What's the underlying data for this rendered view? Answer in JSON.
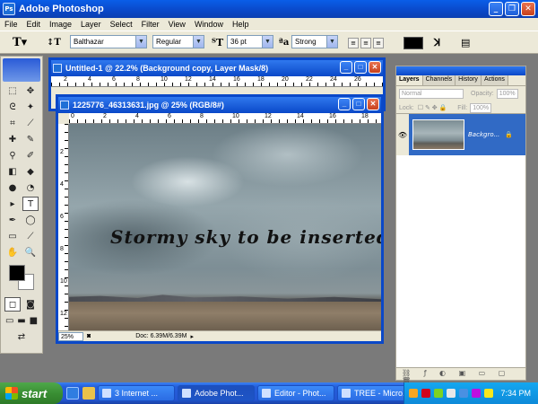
{
  "app": {
    "title": "Adobe Photoshop",
    "logo_text": "Ps"
  },
  "menu": [
    "File",
    "Edit",
    "Image",
    "Layer",
    "Select",
    "Filter",
    "View",
    "Window",
    "Help"
  ],
  "options": {
    "font_family": "Balthazar",
    "font_style": "Regular",
    "font_size": "36 pt",
    "aa_label": "a",
    "antialias": "Strong"
  },
  "doc_back": {
    "title": "Untitled-1 @ 22.2% (Background copy, Layer Mask/8)"
  },
  "doc_front": {
    "title": "1225776_46313631.jpg @ 25% (RGB/8#)",
    "caption": "Stormy sky to be inserted",
    "zoom": "25%",
    "doc_info": "Doc: 6.39M/6.39M",
    "ruler_h": [
      "0",
      "2",
      "4",
      "6",
      "8",
      "10",
      "12",
      "14",
      "16",
      "18"
    ],
    "ruler_v": [
      "2",
      "4",
      "6",
      "8",
      "10",
      "12"
    ]
  },
  "doc_back_ruler": [
    "2",
    "4",
    "6",
    "8",
    "10",
    "12",
    "14",
    "16",
    "18",
    "20",
    "22",
    "24",
    "26"
  ],
  "layers_panel": {
    "tabs": [
      "Layers",
      "Channels",
      "History",
      "Actions"
    ],
    "blend_mode": "Normal",
    "opacity_label": "Opacity:",
    "opacity": "100%",
    "lock_label": "Lock:",
    "fill_label": "Fill:",
    "fill": "100%",
    "layer_name": "Backgro..."
  },
  "taskbar": {
    "start": "start",
    "tasks": [
      {
        "label": "3 Internet ...",
        "active": false
      },
      {
        "label": "Adobe Phot...",
        "active": true
      },
      {
        "label": "Editor - Phot...",
        "active": false
      },
      {
        "label": "TREE - Micro...",
        "active": false
      }
    ],
    "time": "7:34 PM"
  },
  "colors": {
    "titlebar": "#0a48c8",
    "layer_selected": "#316ac5",
    "taskbar": "#245edb",
    "start": "#3a8f34"
  }
}
